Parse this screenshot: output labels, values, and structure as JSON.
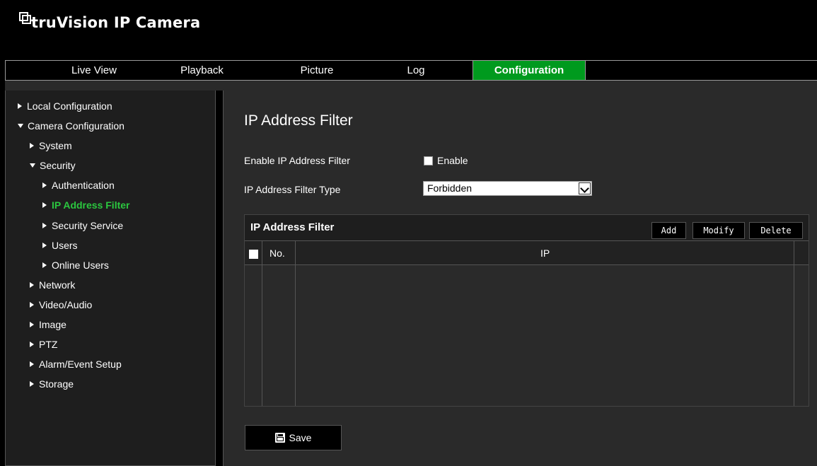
{
  "app": {
    "title": "truVision IP Camera"
  },
  "nav": {
    "tabs": [
      {
        "label": "Live View"
      },
      {
        "label": "Playback"
      },
      {
        "label": "Picture"
      },
      {
        "label": "Log"
      },
      {
        "label": "Configuration",
        "active": true
      }
    ]
  },
  "sidebar": {
    "items": [
      {
        "label": "Local Configuration",
        "expanded": false
      },
      {
        "label": "Camera Configuration",
        "expanded": true
      },
      {
        "label": "System",
        "expanded": false
      },
      {
        "label": "Security",
        "expanded": true
      },
      {
        "label": "Authentication"
      },
      {
        "label": "IP Address Filter",
        "active": true
      },
      {
        "label": "Security Service"
      },
      {
        "label": "Users"
      },
      {
        "label": "Online Users"
      },
      {
        "label": "Network"
      },
      {
        "label": "Video/Audio"
      },
      {
        "label": "Image"
      },
      {
        "label": "PTZ"
      },
      {
        "label": "Alarm/Event Setup"
      },
      {
        "label": "Storage"
      }
    ]
  },
  "main": {
    "title": "IP Address Filter",
    "enable": {
      "label": "Enable IP Address Filter",
      "checkbox_label": "Enable",
      "checked": false
    },
    "filter_type": {
      "label": "IP Address Filter Type",
      "value": "Forbidden"
    },
    "panel": {
      "title": "IP Address Filter",
      "buttons": {
        "add": "Add",
        "modify": "Modify",
        "delete": "Delete"
      },
      "columns": {
        "no": "No.",
        "ip": "IP"
      },
      "rows": []
    },
    "save_label": "Save"
  },
  "colors": {
    "accent": "#009a1e",
    "active_text": "#2bc73f",
    "background": "#2a2a2a"
  }
}
